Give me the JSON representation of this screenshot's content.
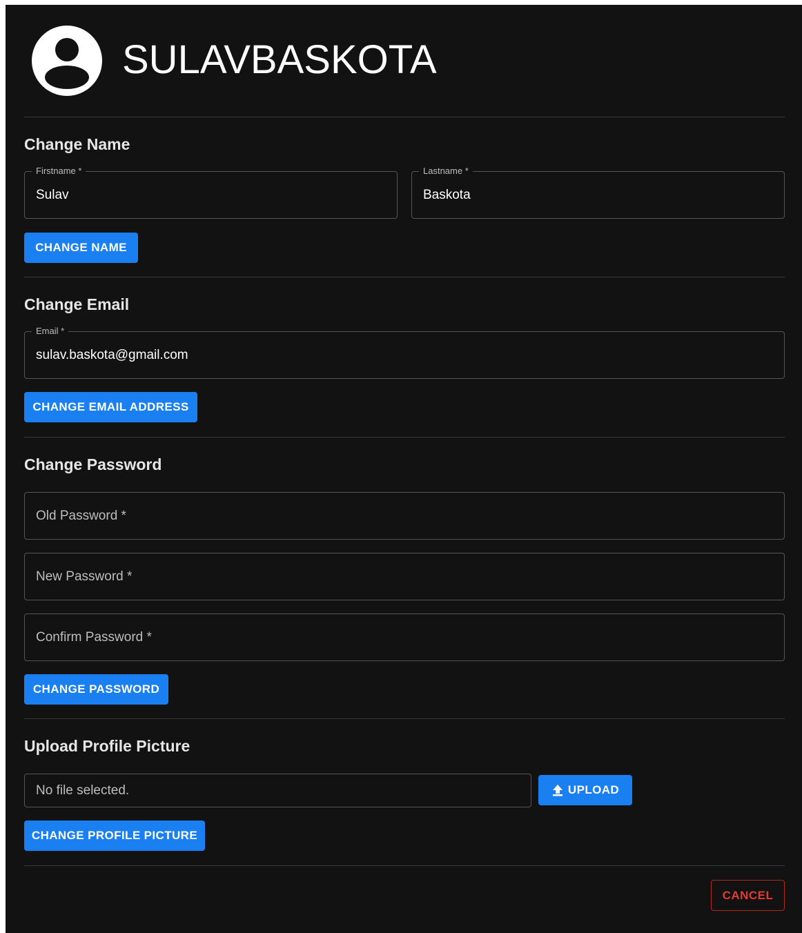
{
  "user": {
    "username": "SULAVBASKOTA"
  },
  "name_section": {
    "title": "Change Name",
    "firstname": {
      "label": "Firstname *",
      "value": "Sulav"
    },
    "lastname": {
      "label": "Lastname *",
      "value": "Baskota"
    },
    "button": "CHANGE NAME"
  },
  "email_section": {
    "title": "Change Email",
    "email": {
      "label": "Email *",
      "value": "sulav.baskota@gmail.com"
    },
    "button": "CHANGE EMAIL ADDRESS"
  },
  "password_section": {
    "title": "Change Password",
    "old_password": {
      "placeholder": "Old Password *"
    },
    "new_password": {
      "placeholder": "New Password *"
    },
    "confirm_password": {
      "placeholder": "Confirm Password *"
    },
    "button": "CHANGE PASSWORD"
  },
  "picture_section": {
    "title": "Upload Profile Picture",
    "file_placeholder": "No file selected.",
    "upload_button": "UPLOAD",
    "button": "CHANGE PROFILE PICTURE"
  },
  "footer": {
    "cancel": "CANCEL"
  },
  "colors": {
    "background": "#121212",
    "primary": "#1a7ff0",
    "danger": "#e53935",
    "text": "#ffffff",
    "muted": "#bdbdbd",
    "border": "#555555"
  },
  "icons": {
    "avatar": "account-circle-icon",
    "upload": "upload-arrow-icon"
  }
}
